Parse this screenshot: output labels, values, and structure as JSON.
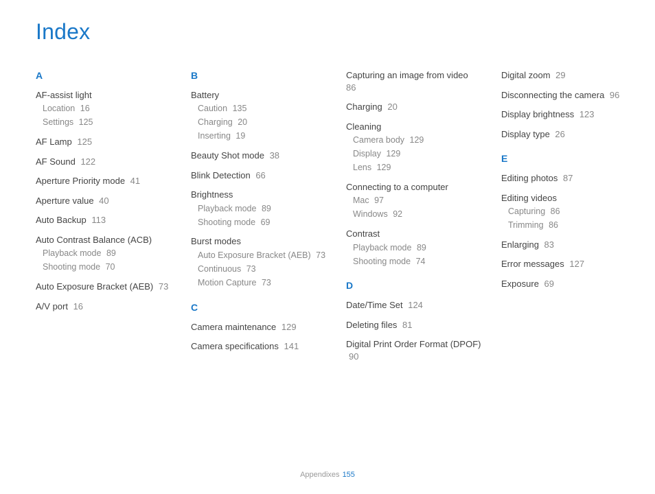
{
  "title": "Index",
  "footer": {
    "section": "Appendixes",
    "page": "155"
  },
  "cols": [
    [
      {
        "type": "letter",
        "text": "A"
      },
      {
        "type": "entry",
        "main": "AF-assist light",
        "subs": [
          {
            "label": "Location",
            "page": "16"
          },
          {
            "label": "Settings",
            "page": "125"
          }
        ]
      },
      {
        "type": "entry",
        "main": "AF Lamp",
        "page": "125"
      },
      {
        "type": "entry",
        "main": "AF Sound",
        "page": "122"
      },
      {
        "type": "entry",
        "main": "Aperture Priority mode",
        "page": "41"
      },
      {
        "type": "entry",
        "main": "Aperture value",
        "page": "40"
      },
      {
        "type": "entry",
        "main": "Auto Backup",
        "page": "113"
      },
      {
        "type": "entry",
        "main": "Auto Contrast Balance (ACB)",
        "subs": [
          {
            "label": "Playback mode",
            "page": "89"
          },
          {
            "label": "Shooting mode",
            "page": "70"
          }
        ]
      },
      {
        "type": "entry",
        "main": "Auto Exposure Bracket (AEB)",
        "page": "73"
      },
      {
        "type": "entry",
        "main": "A/V port",
        "page": "16"
      }
    ],
    [
      {
        "type": "letter",
        "text": "B"
      },
      {
        "type": "entry",
        "main": "Battery",
        "subs": [
          {
            "label": "Caution",
            "page": "135"
          },
          {
            "label": "Charging",
            "page": "20"
          },
          {
            "label": "Inserting",
            "page": "19"
          }
        ]
      },
      {
        "type": "entry",
        "main": "Beauty Shot mode",
        "page": "38"
      },
      {
        "type": "entry",
        "main": "Blink Detection",
        "page": "66"
      },
      {
        "type": "entry",
        "main": "Brightness",
        "subs": [
          {
            "label": "Playback mode",
            "page": "89"
          },
          {
            "label": "Shooting mode",
            "page": "69"
          }
        ]
      },
      {
        "type": "entry",
        "main": "Burst modes",
        "subs": [
          {
            "label": "Auto Exposure Bracket (AEB)",
            "page": "73"
          },
          {
            "label": "Continuous",
            "page": "73"
          },
          {
            "label": "Motion Capture",
            "page": "73"
          }
        ]
      },
      {
        "type": "letter",
        "text": "C",
        "mt": true
      },
      {
        "type": "entry",
        "main": "Camera maintenance",
        "page": "129"
      },
      {
        "type": "entry",
        "main": "Camera specifications",
        "page": "141"
      }
    ],
    [
      {
        "type": "entry",
        "main": "Capturing an image from video",
        "page": "86"
      },
      {
        "type": "entry",
        "main": "Charging",
        "page": "20"
      },
      {
        "type": "entry",
        "main": "Cleaning",
        "subs": [
          {
            "label": "Camera body",
            "page": "129"
          },
          {
            "label": "Display",
            "page": "129"
          },
          {
            "label": "Lens",
            "page": "129"
          }
        ]
      },
      {
        "type": "entry",
        "main": "Connecting to a computer",
        "subs": [
          {
            "label": "Mac",
            "page": "97"
          },
          {
            "label": "Windows",
            "page": "92"
          }
        ]
      },
      {
        "type": "entry",
        "main": "Contrast",
        "subs": [
          {
            "label": "Playback mode",
            "page": "89"
          },
          {
            "label": "Shooting mode",
            "page": "74"
          }
        ]
      },
      {
        "type": "letter",
        "text": "D",
        "mt": true
      },
      {
        "type": "entry",
        "main": "Date/Time Set",
        "page": "124"
      },
      {
        "type": "entry",
        "main": "Deleting files",
        "page": "81"
      },
      {
        "type": "entry",
        "main": "Digital Print Order Format (DPOF)",
        "page": "90"
      }
    ],
    [
      {
        "type": "entry",
        "main": "Digital zoom",
        "page": "29"
      },
      {
        "type": "entry",
        "main": "Disconnecting the camera",
        "page": "96"
      },
      {
        "type": "entry",
        "main": "Display brightness",
        "page": "123"
      },
      {
        "type": "entry",
        "main": "Display type",
        "page": "26"
      },
      {
        "type": "letter",
        "text": "E",
        "mt": true
      },
      {
        "type": "entry",
        "main": "Editing photos",
        "page": "87"
      },
      {
        "type": "entry",
        "main": "Editing videos",
        "subs": [
          {
            "label": "Capturing",
            "page": "86"
          },
          {
            "label": "Trimming",
            "page": "86"
          }
        ]
      },
      {
        "type": "entry",
        "main": "Enlarging",
        "page": "83"
      },
      {
        "type": "entry",
        "main": "Error messages",
        "page": "127"
      },
      {
        "type": "entry",
        "main": "Exposure",
        "page": "69"
      }
    ]
  ]
}
